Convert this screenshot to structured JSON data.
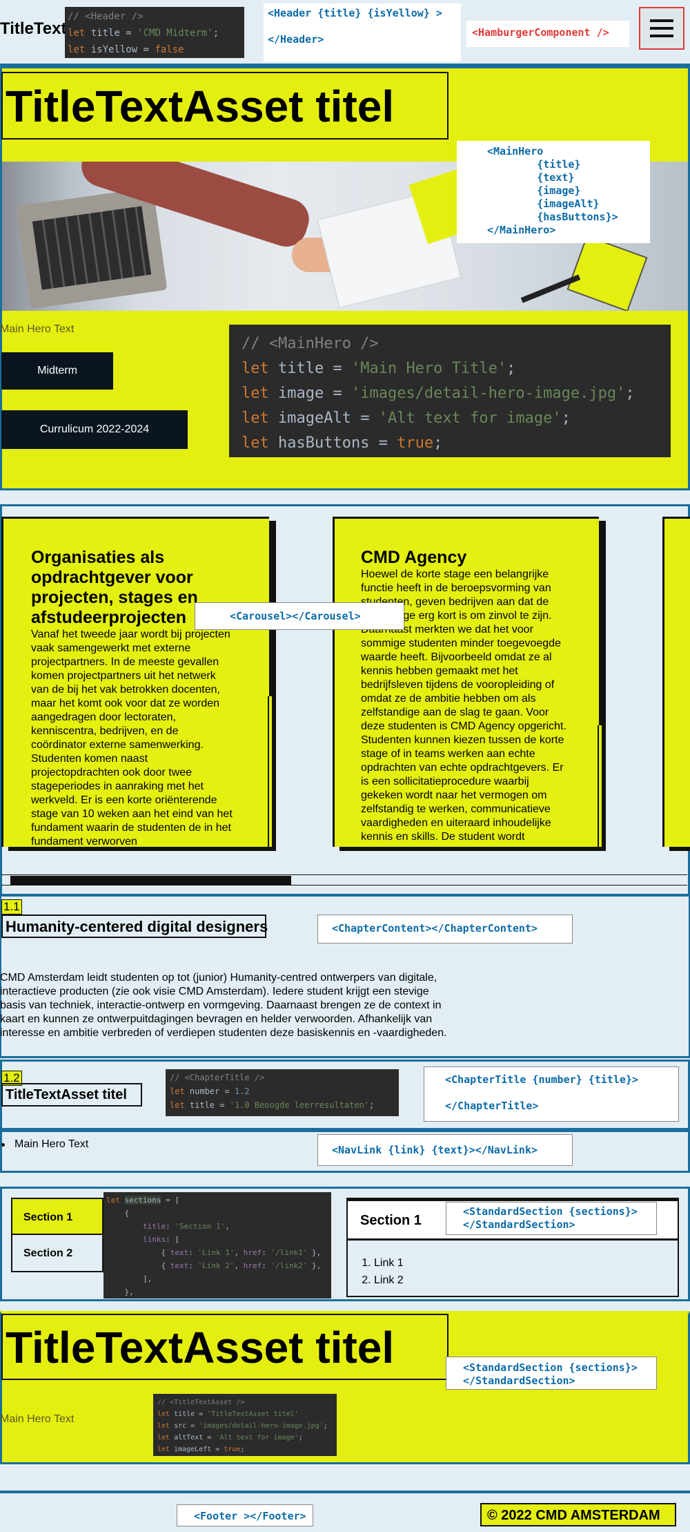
{
  "header": {
    "title": "TitleText",
    "code": [
      "// <Header />",
      "let title = 'CMD Midterm';",
      "let isYellow = false"
    ],
    "component_tag_line1": "<Header {title} {isYellow} >",
    "component_tag_line2": "</Header>",
    "hamburger_tag": "<HamburgerComponent />",
    "hamburger_icon": "hamburger-icon"
  },
  "main_hero": {
    "title": "TitleTextAsset titel",
    "component_tag": [
      "<MainHero",
      "        {title}",
      "        {text}",
      "        {image}",
      "        {imageAlt}",
      "        {hasButtons}>",
      "</MainHero>"
    ],
    "text": "Main Hero Text",
    "buttons": [
      "Midterm",
      "Currulicum 2022-2024"
    ],
    "code": [
      "// <MainHero />",
      "let title = 'Main Hero Title';",
      "let image = 'images/detail-hero-image.jpg';",
      "let imageAlt = 'Alt text for image';",
      "let hasButtons = true;"
    ]
  },
  "carousel": {
    "tag": "<Carousel></Carousel>",
    "cards": [
      {
        "title": "Organisaties als opdrachtgever voor projecten, stages en afstudeerprojecten",
        "body": "Vanaf het tweede jaar wordt bij projecten vaak samengewerkt met externe projectpartners. In de meeste gevallen komen projectpartners uit het netwerk van de bij het vak betrokken docenten, maar het komt ook voor dat ze worden aangedragen door lectoraten, kenniscentra, bedrijven, en de coördinator externe samenwerking. Studenten komen naast projectopdrachten ook door twee stageperiodes in aanraking met het werkveld. Er is een korte oriënterende stage van 10 weken aan het eind van het fundament waarin de studenten de in het fundament verworven"
      },
      {
        "title": "CMD Agency",
        "body": "Hoewel de korte stage een belangrijke functie heeft in de beroepsvorming van studenten, geven bedrijven aan dat de korte stage erg kort is om zinvol te zijn. Daarnaast merkten we dat het voor sommige studenten minder toegevoegde waarde heeft. Bijvoorbeeld omdat ze al kennis hebben gemaakt met het bedrijfsleven tijdens de vooropleiding of omdat ze de ambitie hebben om als zelfstandige aan de slag te gaan. Voor deze studenten is CMD Agency opgericht. Studenten kunnen kiezen tussen de korte stage of in teams werken aan echte opdrachten van echte opdrachtgevers. Er is een sollicitatieprocedure waarbij gekeken wordt naar het vermogen om zelfstandig te werken, communicatieve vaardigheden en uiteraard inhoudelijke kennis en skills. De student wordt"
      }
    ],
    "progress": 0.42
  },
  "chapter_1": {
    "number": "1.1",
    "title": "Humanity-centered digital designers",
    "tag": "<ChapterContent></ChapterContent>",
    "body": "CMD Amsterdam leidt studenten op tot (junior) Humanity-centred ontwerpers van digitale, interactieve producten (zie ook visie CMD Amsterdam). Iedere student krijgt een stevige basis van techniek, interactie-ontwerp en vormgeving. Daarnaast brengen ze de context in kaart en kunnen ze ontwerpuitdagingen bevragen en helder verwoorden. Afhankelijk van interesse en ambitie verbreden of verdiepen studenten deze basiskennis en -vaardigheden."
  },
  "chapter_2": {
    "number": "1.2",
    "title": "TitleTextAsset titel",
    "code": [
      "// <ChapterTitle />",
      "let number = 1.2",
      "let title = '1.0 Beoogde leerresultaten';"
    ],
    "tag_line1": "<ChapterTitle {number} {title}>",
    "tag_line2": "</ChapterTitle>"
  },
  "navlink": {
    "text": "Main Hero Text",
    "tag": "<NavLink {link} {text}></NavLink>"
  },
  "standard_section": {
    "tabs": [
      "Section 1",
      "Section 2"
    ],
    "code": [
      "let sections = [",
      "    {",
      "        title: 'Section 1',",
      "        links: [",
      "            { text: 'Link 1', href: '/link1' },",
      "            { text: 'Link 2', href: '/link2' },",
      "        ],",
      "    },"
    ],
    "panel_title": "Section 1",
    "tag": [
      "<StandardSection {sections}>",
      "</StandardSection>"
    ],
    "links": [
      "Link 1",
      "Link 2"
    ]
  },
  "asset_hero": {
    "title": "TitleTextAsset titel",
    "tag": [
      "<StandardSection {sections}>",
      "</StandardSection>"
    ],
    "text": "Main Hero Text",
    "code": [
      "// <TitleTextAsset />",
      "let title = 'TitleTextAsset titel'",
      "let src = 'images/detail-hero-image.jpg';",
      "let altText = 'Alt text for image';",
      "let imageLeft = true;"
    ]
  },
  "footer": {
    "tag": "<Footer ></Footer>",
    "copyright": "© 2022 CMD AMSTERDAM"
  },
  "colors": {
    "accent_yellow": "#e4ef10",
    "frame_blue": "#1a6e9e",
    "tag_blue": "#0c6ba8",
    "hamburger_red": "#e03a3a",
    "code_bg": "#2b2b2b"
  }
}
